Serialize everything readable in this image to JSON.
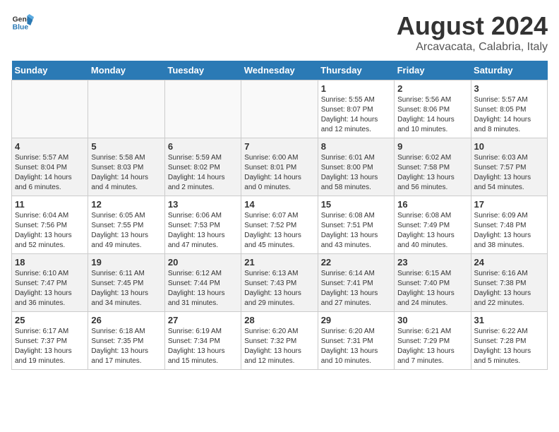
{
  "header": {
    "logo_line1": "General",
    "logo_line2": "Blue",
    "main_title": "August 2024",
    "subtitle": "Arcavacata, Calabria, Italy"
  },
  "weekdays": [
    "Sunday",
    "Monday",
    "Tuesday",
    "Wednesday",
    "Thursday",
    "Friday",
    "Saturday"
  ],
  "weeks": [
    [
      {
        "day": "",
        "info": ""
      },
      {
        "day": "",
        "info": ""
      },
      {
        "day": "",
        "info": ""
      },
      {
        "day": "",
        "info": ""
      },
      {
        "day": "1",
        "info": "Sunrise: 5:55 AM\nSunset: 8:07 PM\nDaylight: 14 hours\nand 12 minutes."
      },
      {
        "day": "2",
        "info": "Sunrise: 5:56 AM\nSunset: 8:06 PM\nDaylight: 14 hours\nand 10 minutes."
      },
      {
        "day": "3",
        "info": "Sunrise: 5:57 AM\nSunset: 8:05 PM\nDaylight: 14 hours\nand 8 minutes."
      }
    ],
    [
      {
        "day": "4",
        "info": "Sunrise: 5:57 AM\nSunset: 8:04 PM\nDaylight: 14 hours\nand 6 minutes."
      },
      {
        "day": "5",
        "info": "Sunrise: 5:58 AM\nSunset: 8:03 PM\nDaylight: 14 hours\nand 4 minutes."
      },
      {
        "day": "6",
        "info": "Sunrise: 5:59 AM\nSunset: 8:02 PM\nDaylight: 14 hours\nand 2 minutes."
      },
      {
        "day": "7",
        "info": "Sunrise: 6:00 AM\nSunset: 8:01 PM\nDaylight: 14 hours\nand 0 minutes."
      },
      {
        "day": "8",
        "info": "Sunrise: 6:01 AM\nSunset: 8:00 PM\nDaylight: 13 hours\nand 58 minutes."
      },
      {
        "day": "9",
        "info": "Sunrise: 6:02 AM\nSunset: 7:58 PM\nDaylight: 13 hours\nand 56 minutes."
      },
      {
        "day": "10",
        "info": "Sunrise: 6:03 AM\nSunset: 7:57 PM\nDaylight: 13 hours\nand 54 minutes."
      }
    ],
    [
      {
        "day": "11",
        "info": "Sunrise: 6:04 AM\nSunset: 7:56 PM\nDaylight: 13 hours\nand 52 minutes."
      },
      {
        "day": "12",
        "info": "Sunrise: 6:05 AM\nSunset: 7:55 PM\nDaylight: 13 hours\nand 49 minutes."
      },
      {
        "day": "13",
        "info": "Sunrise: 6:06 AM\nSunset: 7:53 PM\nDaylight: 13 hours\nand 47 minutes."
      },
      {
        "day": "14",
        "info": "Sunrise: 6:07 AM\nSunset: 7:52 PM\nDaylight: 13 hours\nand 45 minutes."
      },
      {
        "day": "15",
        "info": "Sunrise: 6:08 AM\nSunset: 7:51 PM\nDaylight: 13 hours\nand 43 minutes."
      },
      {
        "day": "16",
        "info": "Sunrise: 6:08 AM\nSunset: 7:49 PM\nDaylight: 13 hours\nand 40 minutes."
      },
      {
        "day": "17",
        "info": "Sunrise: 6:09 AM\nSunset: 7:48 PM\nDaylight: 13 hours\nand 38 minutes."
      }
    ],
    [
      {
        "day": "18",
        "info": "Sunrise: 6:10 AM\nSunset: 7:47 PM\nDaylight: 13 hours\nand 36 minutes."
      },
      {
        "day": "19",
        "info": "Sunrise: 6:11 AM\nSunset: 7:45 PM\nDaylight: 13 hours\nand 34 minutes."
      },
      {
        "day": "20",
        "info": "Sunrise: 6:12 AM\nSunset: 7:44 PM\nDaylight: 13 hours\nand 31 minutes."
      },
      {
        "day": "21",
        "info": "Sunrise: 6:13 AM\nSunset: 7:43 PM\nDaylight: 13 hours\nand 29 minutes."
      },
      {
        "day": "22",
        "info": "Sunrise: 6:14 AM\nSunset: 7:41 PM\nDaylight: 13 hours\nand 27 minutes."
      },
      {
        "day": "23",
        "info": "Sunrise: 6:15 AM\nSunset: 7:40 PM\nDaylight: 13 hours\nand 24 minutes."
      },
      {
        "day": "24",
        "info": "Sunrise: 6:16 AM\nSunset: 7:38 PM\nDaylight: 13 hours\nand 22 minutes."
      }
    ],
    [
      {
        "day": "25",
        "info": "Sunrise: 6:17 AM\nSunset: 7:37 PM\nDaylight: 13 hours\nand 19 minutes."
      },
      {
        "day": "26",
        "info": "Sunrise: 6:18 AM\nSunset: 7:35 PM\nDaylight: 13 hours\nand 17 minutes."
      },
      {
        "day": "27",
        "info": "Sunrise: 6:19 AM\nSunset: 7:34 PM\nDaylight: 13 hours\nand 15 minutes."
      },
      {
        "day": "28",
        "info": "Sunrise: 6:20 AM\nSunset: 7:32 PM\nDaylight: 13 hours\nand 12 minutes."
      },
      {
        "day": "29",
        "info": "Sunrise: 6:20 AM\nSunset: 7:31 PM\nDaylight: 13 hours\nand 10 minutes."
      },
      {
        "day": "30",
        "info": "Sunrise: 6:21 AM\nSunset: 7:29 PM\nDaylight: 13 hours\nand 7 minutes."
      },
      {
        "day": "31",
        "info": "Sunrise: 6:22 AM\nSunset: 7:28 PM\nDaylight: 13 hours\nand 5 minutes."
      }
    ]
  ]
}
